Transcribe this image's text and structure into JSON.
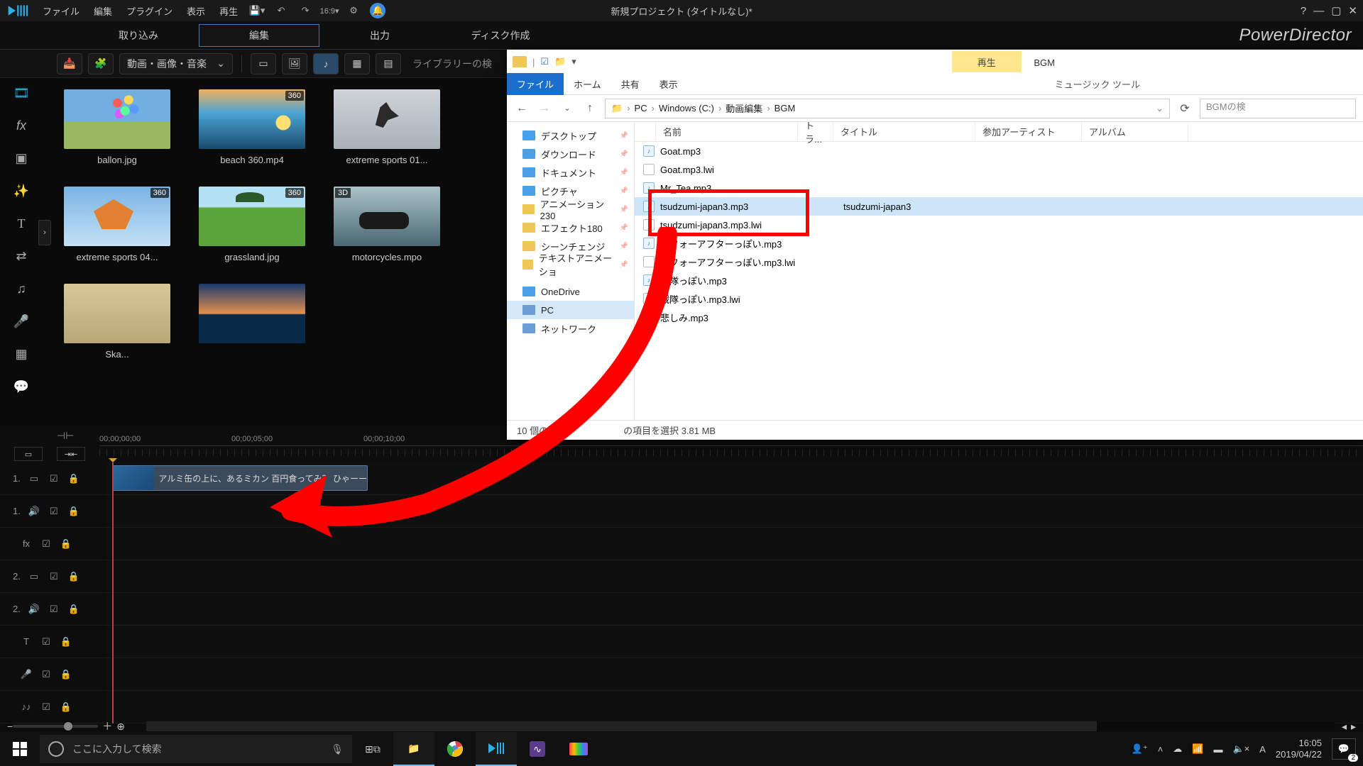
{
  "menu": {
    "items": [
      "ファイル",
      "編集",
      "プラグイン",
      "表示",
      "再生"
    ]
  },
  "title": "新規プロジェクト (タイトルなし)*",
  "help": "?",
  "tabs": {
    "items": [
      "取り込み",
      "編集",
      "出力",
      "ディスク作成"
    ],
    "active": 1
  },
  "brand": "PowerDirector",
  "toolbar": {
    "dropdown": "動画・画像・音楽",
    "search_label": "ライブラリーの検"
  },
  "library": [
    {
      "name": "ballon.jpg",
      "cls": "bg-ballon"
    },
    {
      "name": "beach 360.mp4",
      "cls": "bg-beach",
      "badge": "360"
    },
    {
      "name": "extreme sports 01...",
      "cls": "bg-extreme"
    },
    {
      "name": "extreme sports 04...",
      "cls": "bg-sky",
      "badge": "360"
    },
    {
      "name": "grassland.jpg",
      "cls": "bg-grass",
      "badge": "360"
    },
    {
      "name": "motorcycles.mpo",
      "cls": "bg-moto",
      "badge3d": "3D"
    },
    {
      "name": "Ska...",
      "cls": "bg-skate"
    },
    {
      "name": "",
      "cls": "bg-sunset"
    }
  ],
  "timeline": {
    "ticks": [
      "00;00;00;00",
      "00;00;05;00",
      "00;00;10;00"
    ],
    "clip_text": "アルミ缶の上に、あるミカン  百円食ってみ？ ひゃーー",
    "tracks": [
      {
        "n": "1.",
        "icon": "▭"
      },
      {
        "n": "1.",
        "icon": "🔊"
      },
      {
        "n": "",
        "icon": "fx"
      },
      {
        "n": "2.",
        "icon": "▭"
      },
      {
        "n": "2.",
        "icon": "🔊"
      },
      {
        "n": "",
        "icon": "T"
      },
      {
        "n": "",
        "icon": "🎤"
      },
      {
        "n": "",
        "icon": "♪♪"
      }
    ]
  },
  "explorer": {
    "context_tab": "再生",
    "context_title": "BGM",
    "ribbon": [
      "ファイル",
      "ホーム",
      "共有",
      "表示"
    ],
    "music_tab": "ミュージック ツール",
    "path": [
      "PC",
      "Windows (C:)",
      "動画編集",
      "BGM"
    ],
    "search_ph": "BGMの検",
    "nav": [
      {
        "t": "デスクトップ",
        "i": "blue"
      },
      {
        "t": "ダウンロード",
        "i": "blue"
      },
      {
        "t": "ドキュメント",
        "i": "blue"
      },
      {
        "t": "ピクチャ",
        "i": "blue"
      },
      {
        "t": "アニメーション230",
        "i": "folder"
      },
      {
        "t": "エフェクト180",
        "i": "folder"
      },
      {
        "t": "シーンチェンジ",
        "i": "folder"
      },
      {
        "t": "テキストアニメーショ",
        "i": "folder"
      },
      {
        "t": "OneDrive",
        "i": "blue",
        "sep": true
      },
      {
        "t": "PC",
        "i": "pc",
        "sel": true
      },
      {
        "t": "ネットワーク",
        "i": "pc"
      }
    ],
    "cols": {
      "name": "名前",
      "track": "トラ...",
      "title": "タイトル",
      "artist": "参加アーティスト",
      "album": "アルバム"
    },
    "files": [
      {
        "n": "Goat.mp3",
        "i": "a"
      },
      {
        "n": "Goat.mp3.lwi",
        "i": "p"
      },
      {
        "n": "Mr_Tea.mp3",
        "i": "a"
      },
      {
        "n": "tsudzumi-japan3.mp3",
        "i": "a",
        "sel": true,
        "title": "tsudzumi-japan3"
      },
      {
        "n": "tsudzumi-japan3.mp3.lwi",
        "i": "p"
      },
      {
        "n": "ビフォーアフターっぽい.mp3",
        "i": "a"
      },
      {
        "n": "ビフォーアフターっぽい.mp3.lwi",
        "i": "p"
      },
      {
        "n": "戦隊っぽい.mp3",
        "i": "a"
      },
      {
        "n": "戦隊っぽい.mp3.lwi",
        "i": "p"
      },
      {
        "n": "悲しみ.mp3",
        "i": "a"
      }
    ],
    "status": {
      "count": "10 個の項目",
      "sel": "の項目を選択 3.81 MB"
    }
  },
  "taskbar": {
    "search_ph": "ここに入力して検索",
    "time": "16:05",
    "date": "2019/04/22",
    "notif": "2"
  }
}
